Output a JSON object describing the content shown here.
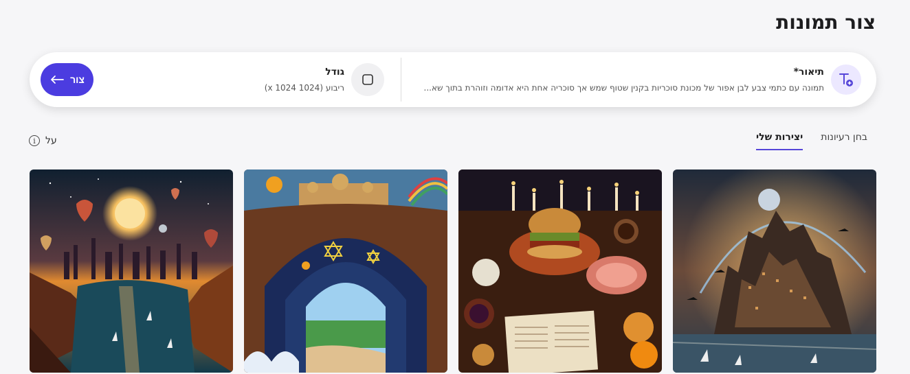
{
  "page": {
    "title": "צור תמונות"
  },
  "prompt": {
    "description_label": "תיאור*",
    "description_text": "תמונה עם כתמי צבע לבן אפור של מכונת סוכריות בקנין שטוף שמש אך סוכריה אחת היא אדומה וזוהרת בתוך שא...",
    "size_label": "גודל",
    "size_value": "ריבוע (1024 x 1024)",
    "create_label": "צור",
    "icons": {
      "description": "text-add-icon",
      "size": "square-icon",
      "create": "arrow-left-icon"
    },
    "accent_color": "#4b3ce0"
  },
  "tabs": [
    {
      "label": "בחן רעיונות",
      "active": false
    },
    {
      "label": "יצירות שלי",
      "active": true
    }
  ],
  "about": {
    "label": "על",
    "icon": "info-icon"
  },
  "gallery": [
    {
      "name": "fantasy-city-sky"
    },
    {
      "name": "festive-food-table"
    },
    {
      "name": "jewish-art-arch"
    },
    {
      "name": "night-city-balloons"
    }
  ]
}
